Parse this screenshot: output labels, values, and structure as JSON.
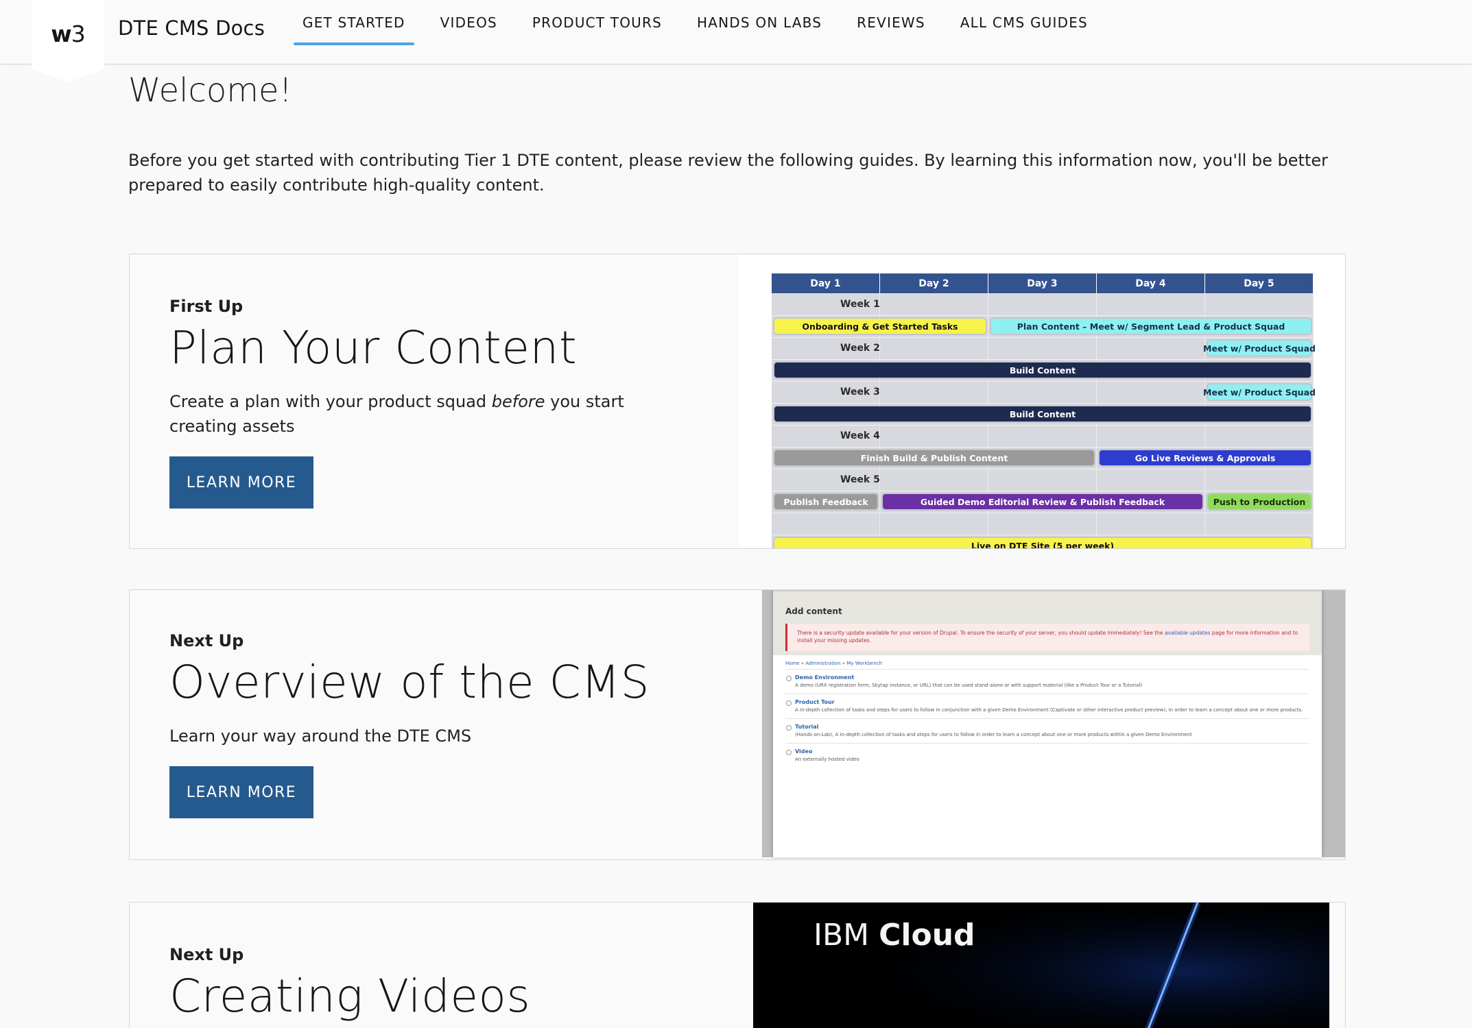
{
  "header": {
    "logo_prefix": "w",
    "logo_suffix": "3",
    "site_title": "DTE CMS Docs",
    "nav": [
      {
        "label": "GET STARTED",
        "active": true
      },
      {
        "label": "VIDEOS",
        "active": false
      },
      {
        "label": "PRODUCT TOURS",
        "active": false
      },
      {
        "label": "HANDS ON LABS",
        "active": false
      },
      {
        "label": "REVIEWS",
        "active": false
      },
      {
        "label": "ALL CMS GUIDES",
        "active": false
      }
    ]
  },
  "intro": {
    "heading": "Welcome!",
    "text": "Before you get started with contributing Tier 1 DTE content, please review the following guides. By learning this information now, you'll be better prepared to easily contribute high-quality content."
  },
  "cards": [
    {
      "eyebrow": "First Up",
      "title": "Plan Your Content",
      "desc_pre": "Create a plan with your product squad ",
      "desc_em": "before",
      "desc_post": " you start creating assets",
      "button": "LEARN MORE"
    },
    {
      "eyebrow": "Next Up",
      "title": "Overview of the CMS",
      "desc": "Learn your way around the DTE CMS",
      "button": "LEARN MORE"
    },
    {
      "eyebrow": "Next Up",
      "title": "Creating Videos"
    }
  ],
  "schedule": {
    "days": [
      "Day 1",
      "Day 2",
      "Day 3",
      "Day 4",
      "Day 5"
    ],
    "weeks": [
      "Week 1",
      "Week 2",
      "Week 3",
      "Week 4",
      "Week 5"
    ],
    "tasks": [
      {
        "label": "Onboarding & Get Started Tasks",
        "color": "#f8f34a",
        "text": "#111"
      },
      {
        "label": "Plan Content – Meet w/ Segment Lead & Product Squad",
        "color": "#8ff0f2",
        "text": "#12334a"
      },
      {
        "label": "Meet w/ Product Squad",
        "color": "#8ff0f2",
        "text": "#12334a"
      },
      {
        "label": "Build Content",
        "color": "#1e2a4f",
        "text": "#ffffff"
      },
      {
        "label": "Meet w/ Product Squad",
        "color": "#8ff0f2",
        "text": "#12334a"
      },
      {
        "label": "Build Content",
        "color": "#1e2a4f",
        "text": "#ffffff"
      },
      {
        "label": "Finish Build & Publish Content",
        "color": "#9a9a9a",
        "text": "#ffffff"
      },
      {
        "label": "Go Live Reviews & Approvals",
        "color": "#2e3ccf",
        "text": "#ffffff"
      },
      {
        "label": "Publish Feedback",
        "color": "#9a9a9a",
        "text": "#ffffff"
      },
      {
        "label": "Guided Demo Editorial Review & Publish Feedback",
        "color": "#6b2fa6",
        "text": "#ffffff"
      },
      {
        "label": "Push to Production",
        "color": "#8fdc5c",
        "text": "#1c2b10"
      },
      {
        "label": "Live on DTE Site (5 per week)",
        "color": "#f8f34a",
        "text": "#111"
      }
    ]
  },
  "cms_screen": {
    "heading": "Add content",
    "alert_pre": "There is a security update available for your version of Drupal. To ensure the security of your server, you should update immediately! See the ",
    "alert_link": "available updates",
    "alert_post": " page for more information and to install your missing updates.",
    "breadcrumb": "Home » Administration » My Workbench",
    "items": [
      {
        "title": "Demo Environment",
        "desc": "A demo (URX registration form, Skytap instance, or URL) that can be used stand-alone or with support material (like a Product Tour or a Tutorial)"
      },
      {
        "title": "Product Tour",
        "desc": "A in-depth collection of tasks and steps for users to follow in conjunction with a given Demo Environment (Captivate or other interactive product preview), in order to learn a concept about one or more products."
      },
      {
        "title": "Tutorial",
        "desc": "(Hands-on-Lab), A in-depth collection of tasks and steps for users to follow in order to learn a concept about one or more products within a given Demo Environment"
      },
      {
        "title": "Video",
        "desc": "An externally hosted video"
      }
    ]
  },
  "video": {
    "brand": "IBM",
    "product": "Cloud"
  },
  "colors": {
    "button": "#255a8e",
    "nav_active_underline": "#4ba3e8",
    "schedule_header": "#33538f"
  }
}
